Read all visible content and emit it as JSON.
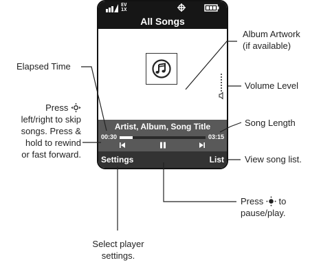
{
  "phone": {
    "status": {
      "signal_icon": "signal-bars-icon",
      "network_badge": "EV 1X",
      "gps_icon": "gps-crosshair-icon",
      "battery_icon": "battery-icon"
    },
    "screen_title": "All Songs",
    "album_icon": "music-note-icon",
    "volume_icon": "speaker-icon",
    "song_title": "Artist, Album, Song Title",
    "elapsed_time": "00:30",
    "song_length": "03:15",
    "progress_fraction": 0.154,
    "controls": [
      "previous-icon",
      "pause-icon",
      "next-icon"
    ],
    "softkeys": {
      "left": "Settings",
      "right": "List"
    }
  },
  "annotations": {
    "album_artwork": [
      "Album Artwork",
      "(if available)"
    ],
    "elapsed_time": "Elapsed Time",
    "volume_level": "Volume Level",
    "press_skip": [
      "Press",
      "left/right to skip",
      "songs. Press &",
      "hold to rewind",
      "or fast forward."
    ],
    "song_length": "Song Length",
    "view_list": "View song list.",
    "pause_play": [
      "Press",
      "to",
      "pause/play."
    ],
    "select_settings": [
      "Select player",
      "settings."
    ]
  }
}
